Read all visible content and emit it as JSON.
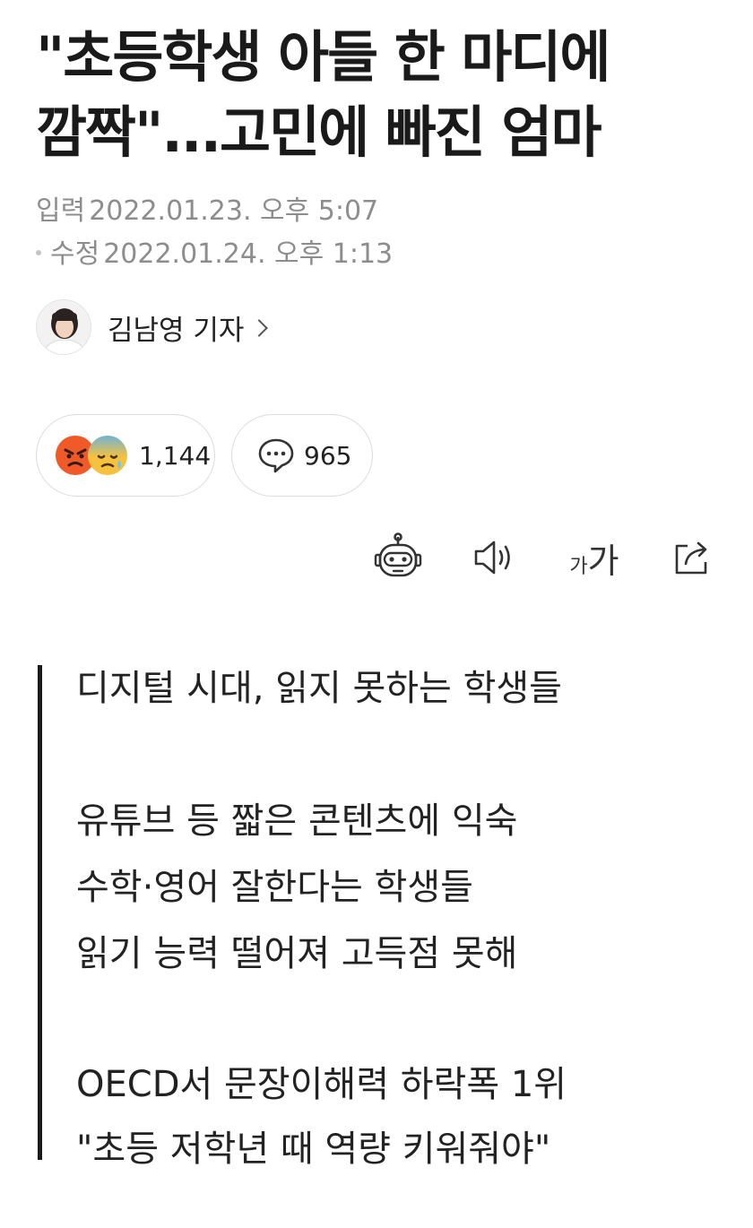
{
  "article": {
    "headline_lines": [
      "\"초등학생 아들 한 마디에",
      "깜짝\"...고민에 빠진 엄마"
    ],
    "input_label": "입력",
    "input_time": "2022.01.23. 오후 5:07",
    "edit_label": "수정",
    "edit_time": "2022.01.24. 오후 1:13"
  },
  "reporter": {
    "name": "김남영 기자"
  },
  "reactions": {
    "count": "1,144",
    "icons": [
      "angry-face-icon",
      "sad-sweat-face-icon"
    ],
    "colors": {
      "angry": "#f05a28",
      "sad": "#f6c23e",
      "sad_top": "#6fb3d6"
    }
  },
  "comments": {
    "count": "965",
    "icon": "speech-bubble-icon"
  },
  "toolbar": {
    "icons": [
      "robot-summary-icon",
      "speaker-icon",
      "font-size-icon",
      "share-icon"
    ],
    "font_small": "가",
    "font_large": "가"
  },
  "summary": {
    "lines": [
      "디지털 시대, 읽지 못하는 학생들",
      "유튜브 등 짧은 콘텐츠에 익숙",
      "수학·영어 잘한다는 학생들",
      "읽기 능력 떨어져 고득점 못해",
      "OECD서 문장이해력 하락폭 1위",
      "\"초등 저학년 때 역량 키워줘야\""
    ]
  }
}
